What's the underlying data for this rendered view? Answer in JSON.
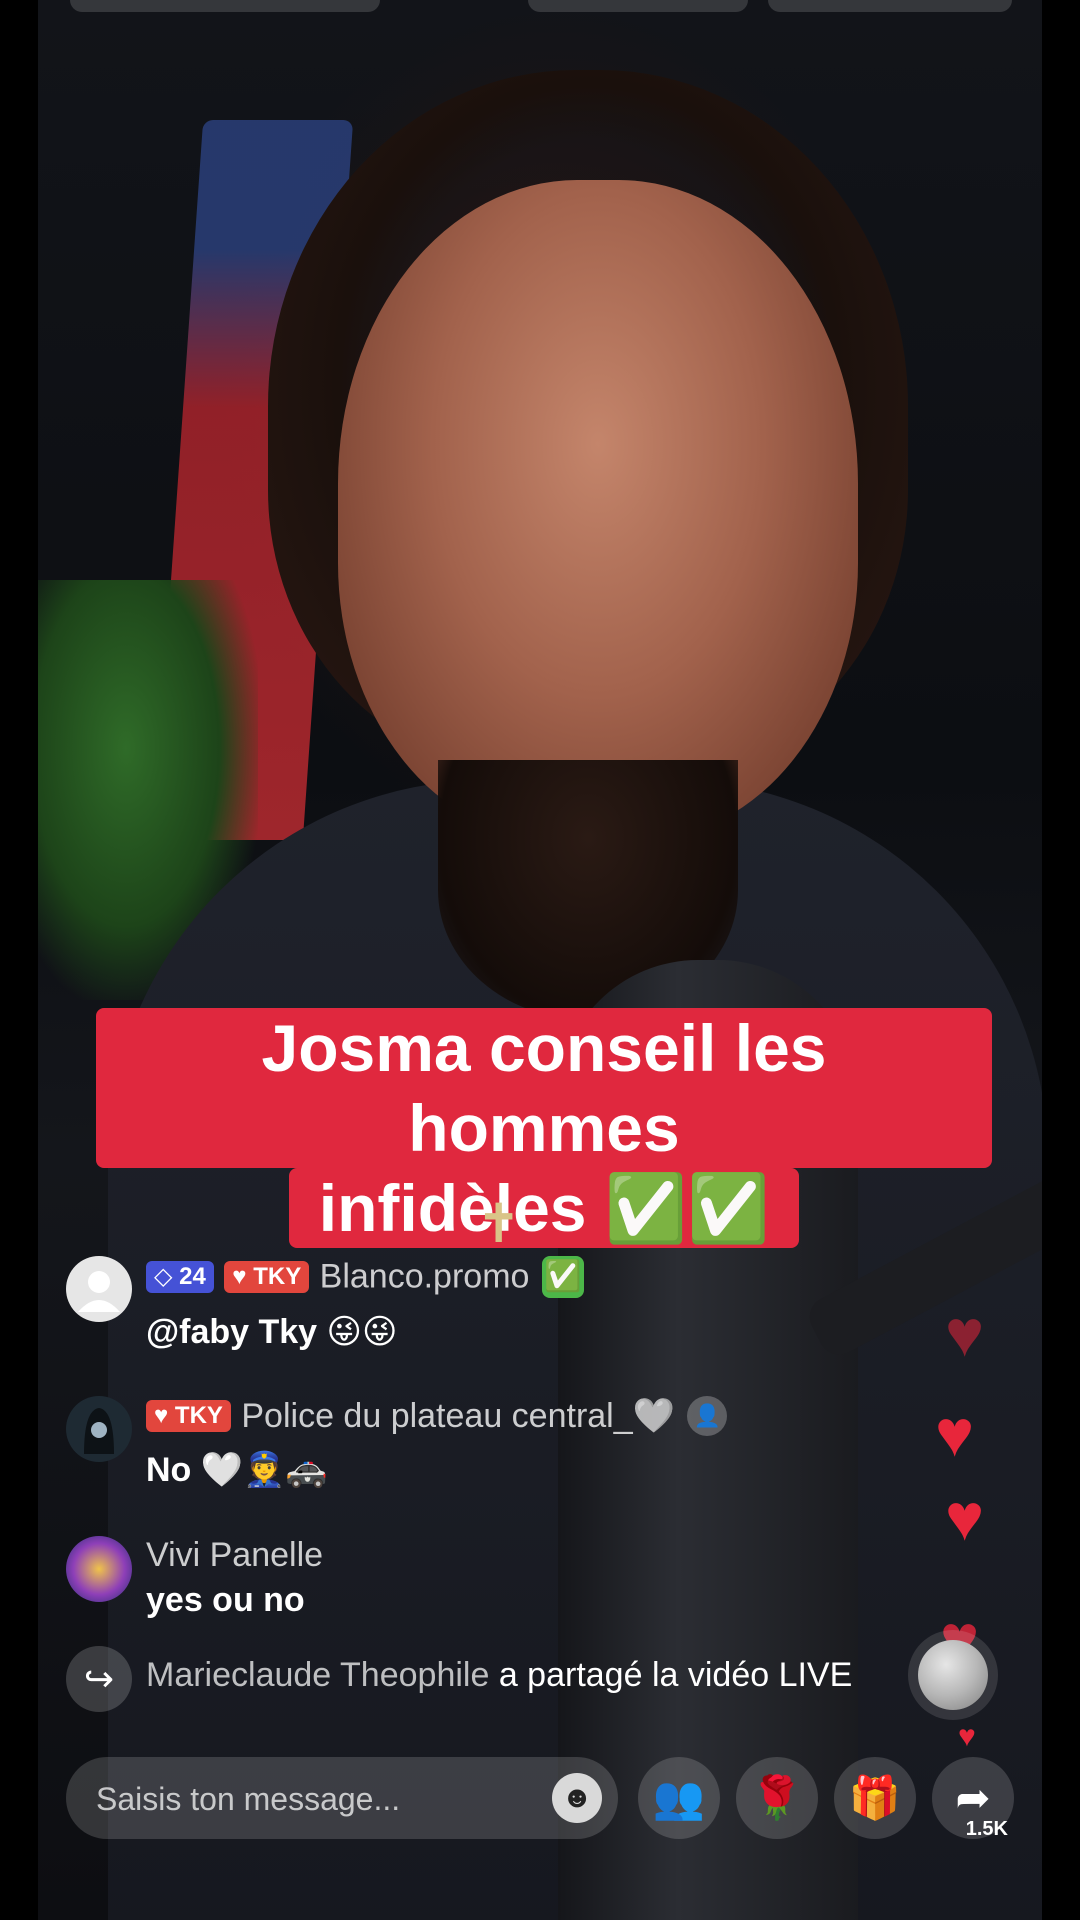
{
  "caption": {
    "line1": "Josma conseil les hommes",
    "line2": "infidèles",
    "emoji": "✅✅"
  },
  "comments": [
    {
      "level_badge": "24",
      "team_badge": "TKY",
      "username": "Blanco.promo",
      "username_suffix": "✅",
      "message": "@faby Tky 😜😜",
      "avatar_icon": "default-avatar-icon"
    },
    {
      "team_badge": "TKY",
      "username": "Police du plateau central_🤍",
      "message": "No 🤍👮🚓",
      "avatar_icon": "hooded-avatar-icon"
    },
    {
      "username": "Vivi Panelle",
      "message": "yes ou no",
      "avatar_icon": "heart-avatar-icon"
    }
  ],
  "share_notice": {
    "user": "Marieclaude Theophile",
    "action": "a partagé la vidéo LIVE"
  },
  "message_input": {
    "placeholder": "Saisis ton message..."
  },
  "actions": {
    "share_count": "1.5K"
  },
  "colors": {
    "caption_bg": "#e0283e",
    "heart": "#e8263b",
    "level_badge": "#4552d6",
    "team_badge": "#e2463d"
  }
}
